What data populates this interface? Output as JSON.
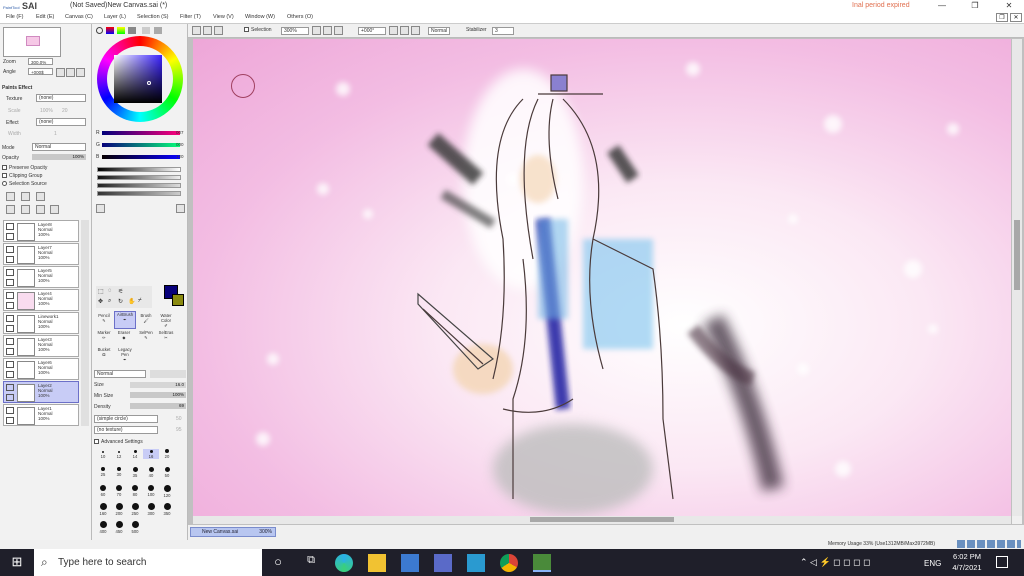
{
  "app": {
    "logo_prefix": "PaintTool",
    "logo_name": "SAI",
    "document_title": "(Not Saved)New Canvas.sai (*)",
    "trial_notice": "Inal period expired"
  },
  "menu": [
    "File (F)",
    "Edit (E)",
    "Canvas (C)",
    "Layer (L)",
    "Selection (S)",
    "Filter (T)",
    "View (V)",
    "Window (W)",
    "Others (O)"
  ],
  "navigator": {
    "zoom_label": "Zoom",
    "zoom_value": "300.0%",
    "angle_label": "Angle",
    "angle_value": "+000$"
  },
  "paint_effect": {
    "header": "Paints Effect",
    "texture_label": "Texture",
    "texture_value": "(none)",
    "scale_label": "Scale",
    "scale_value": "100%",
    "strength_label": "Strength",
    "strength_value": "20",
    "effect_label": "Effect",
    "effect_value": "(none)",
    "width_label": "Width",
    "width_value": "1",
    "width_num": "100"
  },
  "layer_props": {
    "mode_label": "Mode",
    "mode_value": "Normal",
    "opacity_label": "Opacity",
    "opacity_value": "100%",
    "preserve_opacity": "Preserve Opacity",
    "clipping_group": "Clipping Group",
    "selection_source": "Selection Source"
  },
  "layers": [
    {
      "name": "Layer8",
      "mode": "Normal",
      "opacity": "100%"
    },
    {
      "name": "Layer7",
      "mode": "Normal",
      "opacity": "100%"
    },
    {
      "name": "Layer5",
      "mode": "Normal",
      "opacity": "100%"
    },
    {
      "name": "Layer4",
      "mode": "Normal",
      "opacity": "100%"
    },
    {
      "name": "Linework1",
      "mode": "Normal",
      "opacity": "100%"
    },
    {
      "name": "Layer3",
      "mode": "Normal",
      "opacity": "100%"
    },
    {
      "name": "Layer6",
      "mode": "Normal",
      "opacity": "100%"
    },
    {
      "name": "Layer2",
      "mode": "Normal",
      "opacity": "100%"
    },
    {
      "name": "Layer1",
      "mode": "Normal",
      "opacity": "100%"
    }
  ],
  "color": {
    "r_label": "R",
    "r_value": "007",
    "g_label": "G",
    "g_value": "000",
    "b_label": "B",
    "b_value": "120",
    "primary": "#07007a",
    "secondary": "#8a8a10"
  },
  "tools": [
    "Pencil",
    "AirBrush",
    "Brush",
    "Water Color",
    "Marker",
    "Eraser",
    "SelPen",
    "SelEras",
    "Bucket",
    "Legacy Pen"
  ],
  "brush": {
    "mode_value": "Normal",
    "size_label": "Size",
    "size_mult": "x1.0",
    "size_value": "16.0",
    "min_size_label": "Min Size",
    "min_size_value": "100%",
    "density_label": "Density",
    "density_value": "69",
    "shape_value": "(simple circle)",
    "shape_num": "50",
    "texture_value": "(no texture)",
    "texture_num": "95",
    "advanced": "Advanced Settings"
  },
  "brush_sizes": [
    "10",
    "12",
    "14",
    "16",
    "20",
    "25",
    "30",
    "35",
    "40",
    "50",
    "60",
    "70",
    "80",
    "100",
    "120",
    "160",
    "200",
    "250",
    "300",
    "350",
    "400",
    "450",
    "500"
  ],
  "canvas_toolbar": {
    "selection_label": "Selection",
    "zoom_value": "300%",
    "angle_value": "+000°",
    "blend_value": "Normal",
    "stabilizer_label": "Stabilizer",
    "stabilizer_value": "3"
  },
  "canvas_tab": {
    "name": "New Canvas.sai",
    "zoom": "300%"
  },
  "memory": "Memory Usage 33% (Use1312MB/Max3972MB)",
  "taskbar": {
    "search_placeholder": "Type here to search",
    "lang": "ENG",
    "time": "6:02 PM",
    "date": "4/7/2021"
  }
}
